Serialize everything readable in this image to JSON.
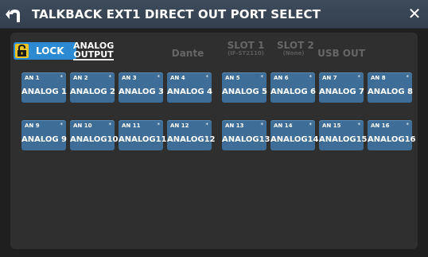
{
  "header": {
    "title": "TALKBACK EXT1 DIRECT OUT PORT SELECT",
    "back_icon": "back-arrow-icon",
    "close_label": "✕"
  },
  "lock": {
    "label": "LOCK",
    "icon": "padlock-icon",
    "state": "unlocked"
  },
  "tabs": [
    {
      "main": "ANALOG",
      "main2": "OUTPUT",
      "sub": "",
      "active": true
    },
    {
      "main": "Dante",
      "sub": "",
      "active": false
    },
    {
      "main": "SLOT 1",
      "sub": "(IF-ST2110)",
      "active": false
    },
    {
      "main": "SLOT 2",
      "sub": "(None)",
      "active": false
    },
    {
      "main": "USB OUT",
      "sub": "",
      "active": false
    }
  ],
  "ports": [
    {
      "num": "AN 1",
      "name": "ANALOG 1"
    },
    {
      "num": "AN 2",
      "name": "ANALOG 2"
    },
    {
      "num": "AN 3",
      "name": "ANALOG 3"
    },
    {
      "num": "AN 4",
      "name": "ANALOG 4"
    },
    {
      "num": "AN 5",
      "name": "ANALOG 5"
    },
    {
      "num": "AN 6",
      "name": "ANALOG 6"
    },
    {
      "num": "AN 7",
      "name": "ANALOG 7"
    },
    {
      "num": "AN 8",
      "name": "ANALOG 8"
    },
    {
      "num": "AN 9",
      "name": "ANALOG 9"
    },
    {
      "num": "AN 10",
      "name": "ANALOG10"
    },
    {
      "num": "AN 11",
      "name": "ANALOG11"
    },
    {
      "num": "AN 12",
      "name": "ANALOG12"
    },
    {
      "num": "AN 13",
      "name": "ANALOG13"
    },
    {
      "num": "AN 14",
      "name": "ANALOG14"
    },
    {
      "num": "AN 15",
      "name": "ANALOG15"
    },
    {
      "num": "AN 16",
      "name": "ANALOG16"
    }
  ],
  "port_marker": "*",
  "colors": {
    "titlebar": "#3a4756",
    "port": "#3e6e97",
    "lock": "#2b8ad1",
    "lock_icon": "#e7c326"
  }
}
